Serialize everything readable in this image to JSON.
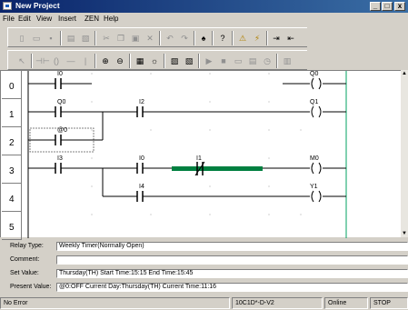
{
  "window": {
    "title": "New Project",
    "minimize": "_",
    "restore": "□",
    "close": "x"
  },
  "menu": [
    "File",
    "Edit",
    "View",
    "Insert",
    "ZEN",
    "Help"
  ],
  "ladder": {
    "rows": [
      "0",
      "1",
      "2",
      "3",
      "4",
      "5"
    ],
    "labels": {
      "r0_contact": "I0",
      "r0_coil": "Q0",
      "r1_contact_a": "Q0",
      "r1_contact_b": "I2",
      "r1_coil": "Q1",
      "r2_contact": "@0",
      "r3_contact_a": "I3",
      "r3_contact_b": "I0",
      "r3_contact_c": "I1",
      "r3_coil": "M0",
      "r4_contact": "I4",
      "r4_coil": "Y1"
    },
    "selected_element": "I1"
  },
  "info": {
    "relay_type_label": "Relay Type:",
    "relay_type_value": "Weekly Timer(Normally Open)",
    "comment_label": "Comment:",
    "comment_value": "",
    "set_value_label": "Set Value:",
    "set_value_value": "Thursday(TH)  Start Time:15:15 End Time:15:45",
    "present_value_label": "Present Value:",
    "present_value_value": "@0:OFF Current Day:Thursday(TH) Current Time:11:16"
  },
  "status": {
    "error": "No Error",
    "model": "10C1D*-D-V2",
    "connection": "Online",
    "mode": "STOP"
  },
  "colors": {
    "title_start": "#0a246a",
    "title_end": "#3a6ea5",
    "highlight": "#008040",
    "rung_right": "#00a060"
  }
}
